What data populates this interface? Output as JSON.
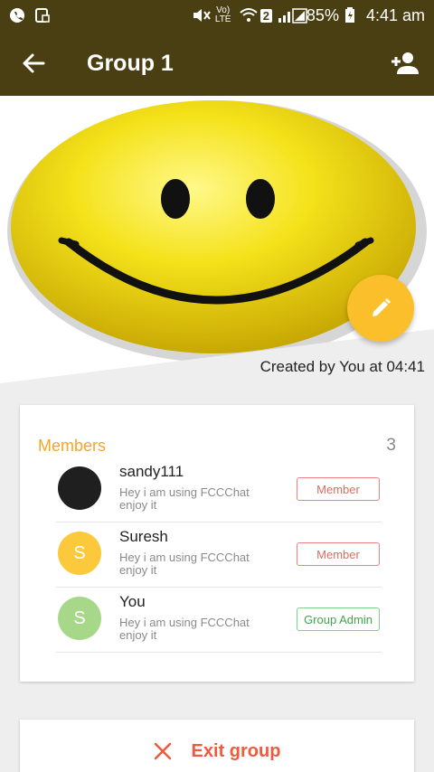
{
  "status_bar": {
    "battery": "85%",
    "time": "4:41 am",
    "sim_badge": "2",
    "volte_label": "Vo) LTE"
  },
  "toolbar": {
    "title": "Group 1"
  },
  "hero": {
    "created_text": "Created by You at 04:41"
  },
  "members": {
    "label": "Members",
    "count": "3",
    "items": [
      {
        "name": "sandy111",
        "status": "Hey i am using FCCChat enjoy it",
        "role": "Member",
        "avatar_letter": "",
        "avatar_color": "#1f1f1f"
      },
      {
        "name": "Suresh",
        "status": "Hey i am using FCCChat enjoy it",
        "role": "Member",
        "avatar_letter": "S",
        "avatar_color": "#fbc93b"
      },
      {
        "name": "You",
        "status": "Hey i am using FCCChat enjoy it",
        "role": "Group Admin",
        "avatar_letter": "S",
        "avatar_color": "#a7d88a"
      }
    ]
  },
  "exit": {
    "label": "Exit group"
  },
  "colors": {
    "toolbar": "#4a3f13",
    "accent": "#fbbf2c",
    "members_label": "#f5a623",
    "exit": "#ee5a3b"
  }
}
